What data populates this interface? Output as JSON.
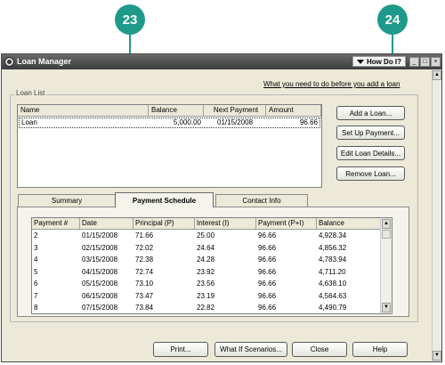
{
  "callouts": [
    "23",
    "24"
  ],
  "window": {
    "title": "Loan Manager",
    "help_button": "How Do I?",
    "min_glyph": "_",
    "max_glyph": "□",
    "close_glyph": "×"
  },
  "guide_link": "What you need to do before you add a loan",
  "loan_list": {
    "label": "Loan List",
    "columns": [
      "Name",
      "Balance",
      "Next Payment",
      "Amount"
    ],
    "row": {
      "name": "Loan",
      "balance": "5,000.00",
      "next_payment": "01/15/2008",
      "amount": "96.66"
    }
  },
  "side_buttons": {
    "add": "Add a Loan...",
    "setup": "Set Up Payment...",
    "edit": "Edit Loan Details...",
    "remove": "Remove Loan..."
  },
  "tabs": {
    "summary": "Summary",
    "schedule": "Payment Schedule",
    "contact": "Contact Info"
  },
  "schedule": {
    "columns": [
      "Payment #",
      "Date",
      "Principal (P)",
      "Interest (I)",
      "Payment (P+I)",
      "Balance"
    ],
    "rows": [
      [
        "2",
        "01/15/2008",
        "71.66",
        "25.00",
        "96.66",
        "4,928.34"
      ],
      [
        "3",
        "02/15/2008",
        "72.02",
        "24.64",
        "96.66",
        "4,856.32"
      ],
      [
        "4",
        "03/15/2008",
        "72.38",
        "24.28",
        "96.66",
        "4,783.94"
      ],
      [
        "5",
        "04/15/2008",
        "72.74",
        "23.92",
        "96.66",
        "4,711.20"
      ],
      [
        "6",
        "05/15/2008",
        "73.10",
        "23.56",
        "96.66",
        "4,638.10"
      ],
      [
        "7",
        "06/15/2008",
        "73.47",
        "23.19",
        "96.66",
        "4,564.63"
      ],
      [
        "8",
        "07/15/2008",
        "73.84",
        "22.82",
        "96.66",
        "4,490.79"
      ]
    ]
  },
  "footer_buttons": {
    "print": "Print...",
    "whatif": "What If Scenarios...",
    "close": "Close",
    "help": "Help"
  }
}
